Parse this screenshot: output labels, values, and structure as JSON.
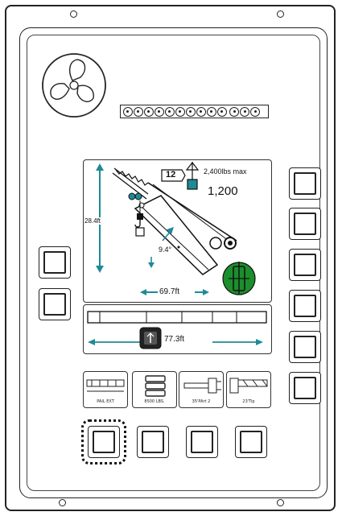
{
  "boom_screen": {
    "max_load_label": "2,400lbs max",
    "current_load": "1,200",
    "reeving_parts": "12",
    "boom_height": "28.4ft",
    "boom_angle": "9.4°",
    "radius": "69.7ft"
  },
  "extension_bar": {
    "length": "77.3ft"
  },
  "function_tiles": [
    {
      "label": "PAIL EXT"
    },
    {
      "label": "8500 LBS."
    },
    {
      "label": "35'PArt 2"
    },
    {
      "label": "23'Tip"
    }
  ],
  "colors": {
    "accent_green": "#1a8f2c",
    "hook_teal": "#1f8a96",
    "frame": "#222222"
  }
}
